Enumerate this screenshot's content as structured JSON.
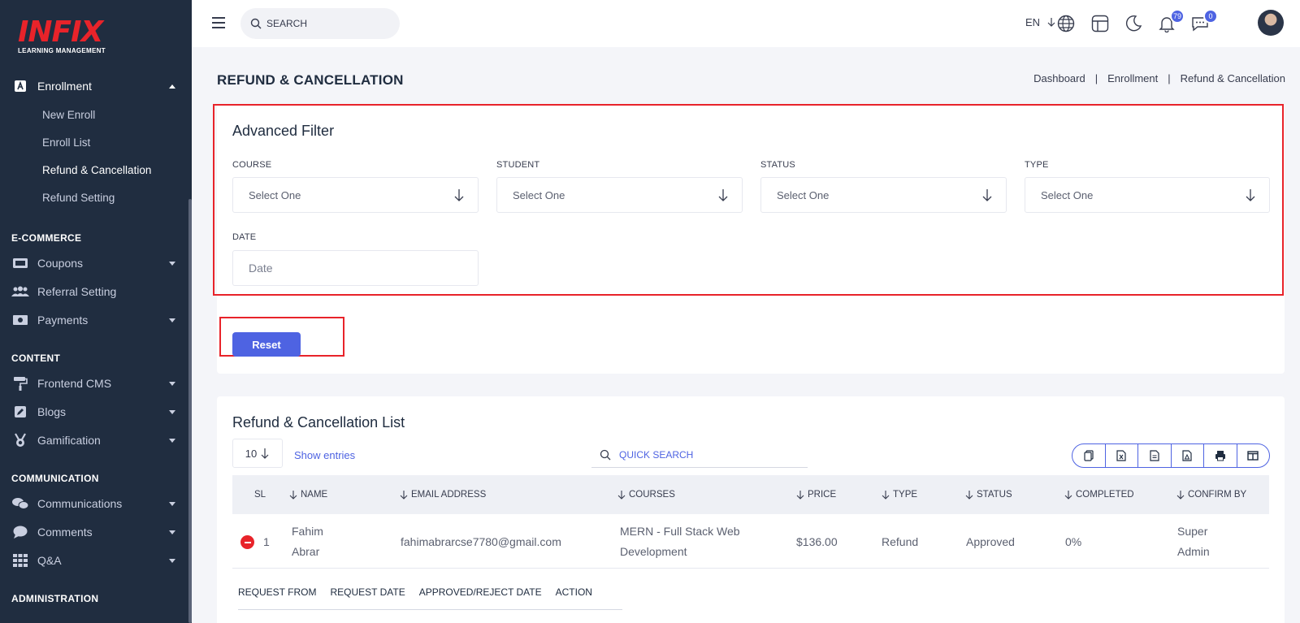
{
  "brand": {
    "name": "INFIX",
    "tagline": "LEARNING MANAGEMENT"
  },
  "sidebar": {
    "enrollment": {
      "label": "Enrollment",
      "items": [
        "New Enroll",
        "Enroll List",
        "Refund & Cancellation",
        "Refund Setting"
      ]
    },
    "sections": [
      "E-COMMERCE",
      "CONTENT",
      "COMMUNICATION",
      "ADMINISTRATION"
    ],
    "ecommerce": [
      "Coupons",
      "Referral Setting",
      "Payments"
    ],
    "content": [
      "Frontend CMS",
      "Blogs",
      "Gamification"
    ],
    "communication": [
      "Communications",
      "Comments",
      "Q&A"
    ]
  },
  "topbar": {
    "search_placeholder": "SEARCH",
    "language": "EN",
    "notifications_count": "79",
    "messages_count": "0"
  },
  "page": {
    "title": "REFUND & CANCELLATION",
    "breadcrumb": [
      "Dashboard",
      "Enrollment",
      "Refund & Cancellation"
    ]
  },
  "filter": {
    "title": "Advanced Filter",
    "course_label": "COURSE",
    "student_label": "STUDENT",
    "status_label": "STATUS",
    "type_label": "TYPE",
    "date_label": "DATE",
    "select_placeholder": "Select One",
    "date_placeholder": "Date",
    "reset_label": "Reset"
  },
  "list": {
    "title": "Refund & Cancellation List",
    "entries_value": "10",
    "show_entries_label": "Show entries",
    "quick_search_placeholder": "QUICK SEARCH",
    "export_buttons": [
      "copy-icon",
      "excel-icon",
      "csv-icon",
      "pdf-icon",
      "print-icon",
      "columns-icon"
    ],
    "columns": [
      "SL",
      "NAME",
      "EMAIL ADDRESS",
      "COURSES",
      "PRICE",
      "TYPE",
      "STATUS",
      "COMPLETED",
      "CONFIRM BY"
    ],
    "rows": [
      {
        "sl": "1",
        "name_line1": "Fahim",
        "name_line2": "Abrar",
        "email": "fahimabrarcse7780@gmail.com",
        "course_line1": "MERN - Full Stack Web",
        "course_line2": "Development",
        "price": "$136.00",
        "type": "Refund",
        "status": "Approved",
        "completed": "0%",
        "confirm_line1": "Super",
        "confirm_line2": "Admin"
      }
    ],
    "child_columns": [
      "REQUEST FROM",
      "REQUEST DATE",
      "APPROVED/REJECT DATE",
      "ACTION"
    ]
  },
  "colors": {
    "accent": "#4e63e2",
    "highlight": "#e8232a",
    "sidebar_bg": "#202d40"
  }
}
